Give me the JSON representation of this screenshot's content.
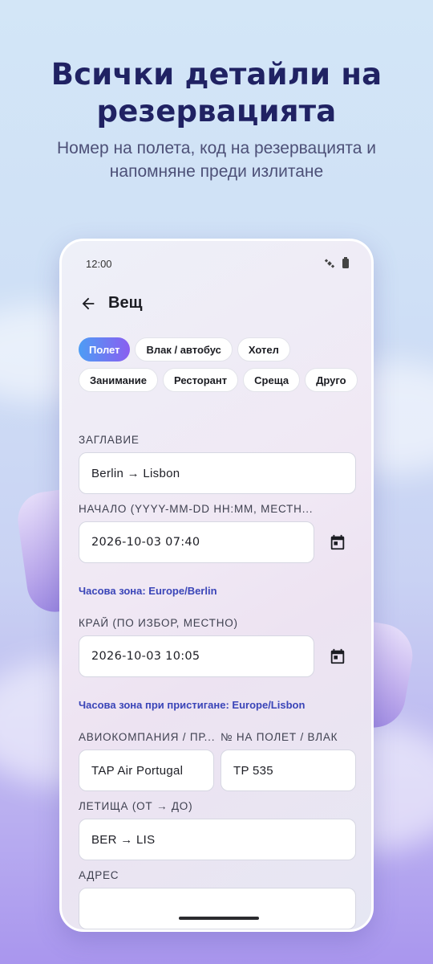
{
  "promo": {
    "title_line1": "Всички детайли на",
    "title_line2": "резервацията",
    "subtitle_line1": "Номер на полета, код на резервацията и",
    "subtitle_line2": "напомняне преди излитане"
  },
  "status_bar": {
    "time": "12:00",
    "icons": [
      "satellite-icon",
      "battery-icon"
    ]
  },
  "app_bar": {
    "title": "Вещ",
    "back_icon": "arrow-left-icon"
  },
  "chips": [
    {
      "label": "Полет",
      "selected": true
    },
    {
      "label": "Влак / автобус",
      "selected": false
    },
    {
      "label": "Хотел",
      "selected": false
    },
    {
      "label": "Занимание",
      "selected": false
    },
    {
      "label": "Ресторант",
      "selected": false
    },
    {
      "label": "Среща",
      "selected": false
    },
    {
      "label": "Друго",
      "selected": false
    }
  ],
  "form": {
    "title_label": "ЗАГЛАВИЕ",
    "title_value": "Berlin → Lisbon",
    "start_label": "НАЧАЛО (YYYY-MM-DD HH:MM, МЕСТН...",
    "start_value": "2026-10-03 07:40",
    "start_timezone": "Часова зона: Europe/Berlin",
    "end_label": "КРАЙ (ПО ИЗБОР, МЕСТНО)",
    "end_value": "2026-10-03 10:05",
    "end_timezone": "Часова зона при пристигане: Europe/Lisbon",
    "airline_label": "АВИОКОМПАНИЯ / ПР...",
    "airline_value": "TAP Air Portugal",
    "flight_label": "№ НА ПОЛЕТ / ВЛАК",
    "flight_value": "TP 535",
    "airports_label": "ЛЕТИЩА (ОТ → ДО)",
    "airports_value": "BER → LIS",
    "address_label": "АДРЕС",
    "address_value": ""
  },
  "colors": {
    "headline": "#202263",
    "accent_start": "#4d9df5",
    "accent_end": "#8a5ef0",
    "timezone_text": "#3a45b8"
  }
}
